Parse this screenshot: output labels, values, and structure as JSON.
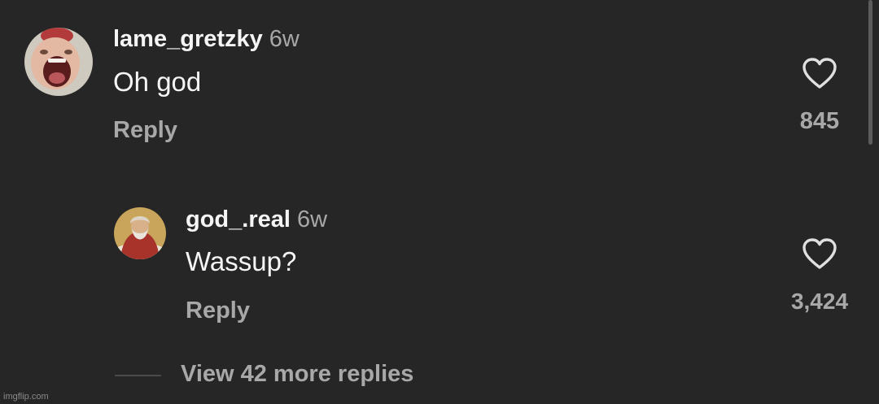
{
  "comments": [
    {
      "username": "lame_gretzky",
      "time": "6w",
      "text": "Oh god",
      "reply_label": "Reply",
      "likes": "845",
      "avatar_icon": "screaming-face-avatar"
    },
    {
      "username": "god_.real",
      "time": "6w",
      "text": "Wassup?",
      "reply_label": "Reply",
      "likes": "3,424",
      "avatar_icon": "painted-god-avatar"
    }
  ],
  "view_more": "View 42 more replies",
  "watermark": "imgflip.com",
  "colors": {
    "background": "#262626",
    "primary_text": "#f5f5f5",
    "secondary_text": "#a8a8a8"
  }
}
